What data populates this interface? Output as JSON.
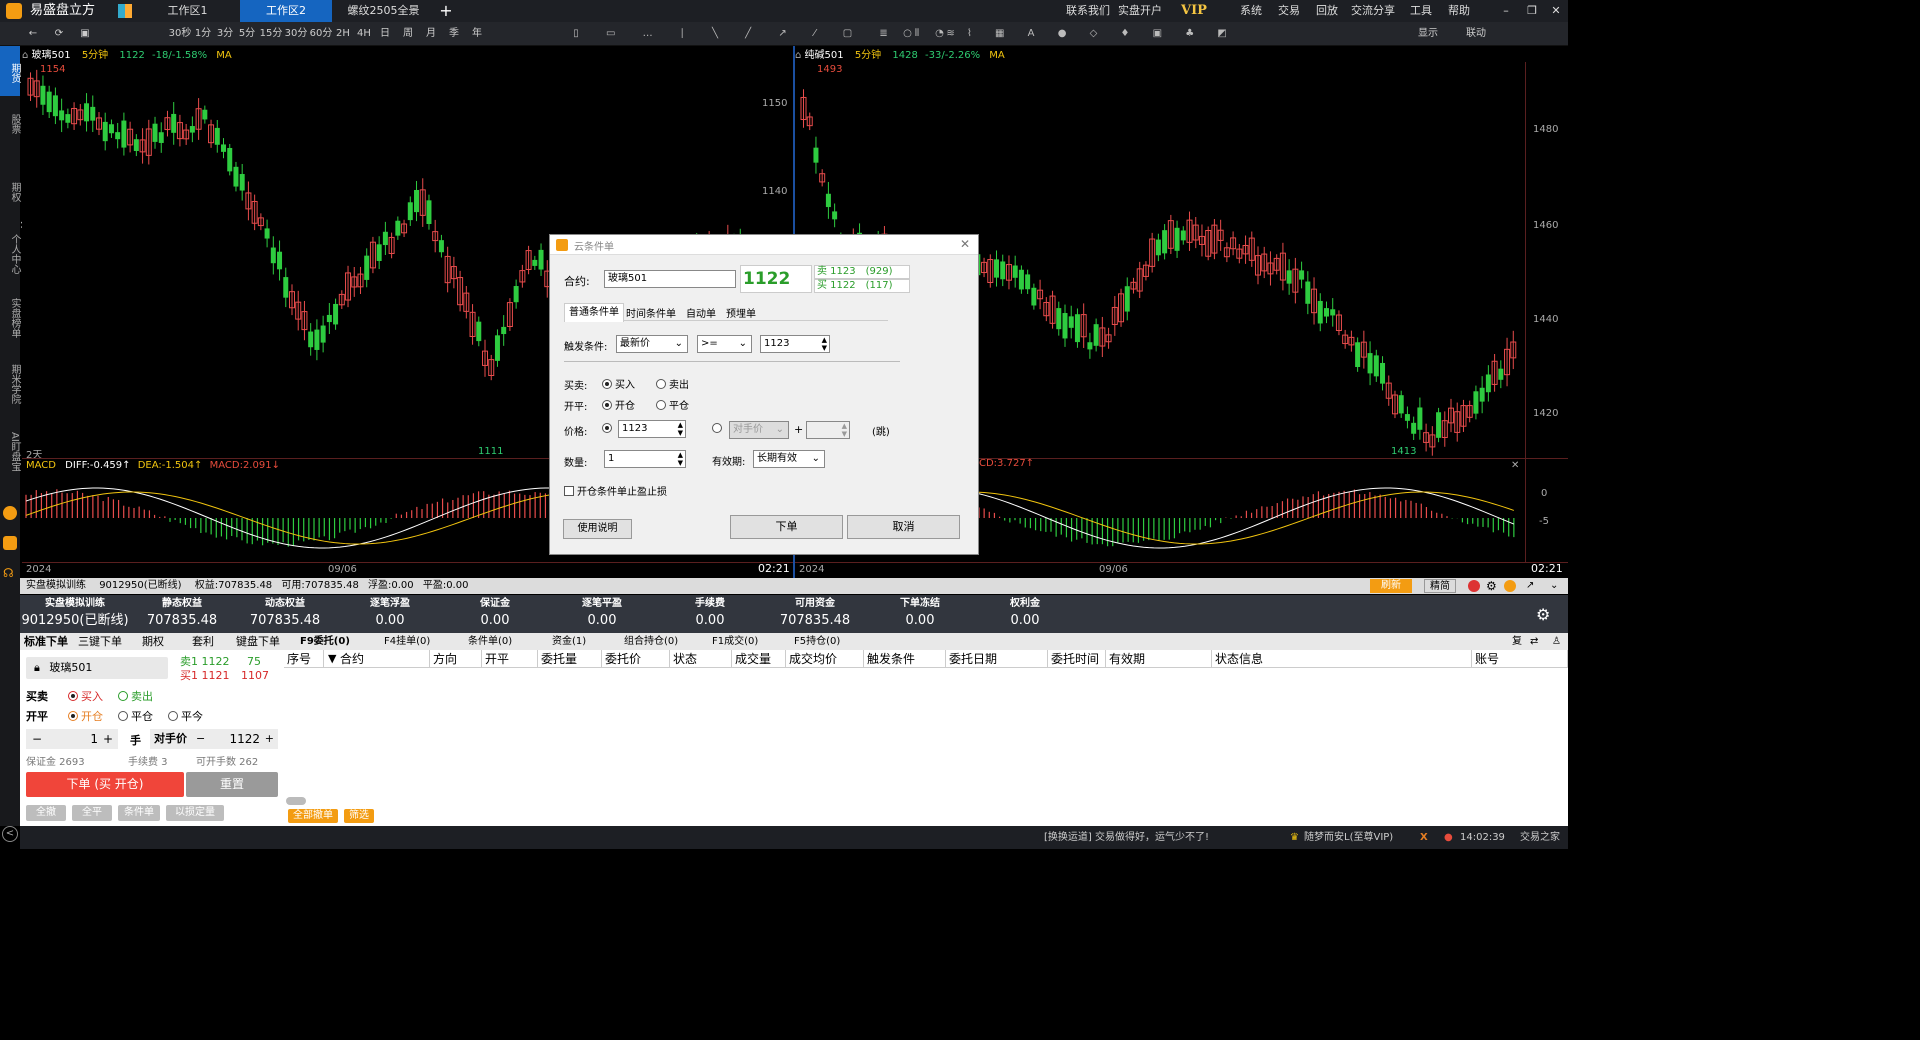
{
  "app": {
    "title": "易盛盘立方",
    "tabs": [
      "工作区1",
      "工作区2",
      "螺纹2505全景"
    ],
    "right_links": [
      "联系我们",
      "实盘开户",
      "VIP",
      "系统",
      "交易",
      "回放",
      "交流分享",
      "工具",
      "帮助"
    ]
  },
  "toolbar": {
    "periods": [
      "30秒",
      "1分",
      "3分",
      "5分",
      "15分",
      "30分",
      "60分",
      "2H",
      "4H",
      "日",
      "周",
      "月",
      "季",
      "年"
    ],
    "right": [
      "显示",
      "联动"
    ]
  },
  "leftnav": [
    "期货",
    "股票",
    "期权",
    "个人中心",
    "实盘榜单",
    "期米学院",
    "AI盯盘宝"
  ],
  "chart_left": {
    "symbol": "玻璃501",
    "period": "5分钟",
    "price": "1122",
    "change": "-18/-1.58%",
    "indicator": "MA",
    "high_label": "1154",
    "low_label": "1111",
    "axis": [
      "1150",
      "1140"
    ],
    "days": "2天",
    "macd": {
      "name": "MACD",
      "diff": "DIFF:-0.459↑",
      "dea": "DEA:-1.504↑",
      "macd": "MACD:2.091↓"
    },
    "dates": [
      "2024",
      "09/06"
    ],
    "time": "02:21"
  },
  "chart_right": {
    "symbol": "纯碱501",
    "period": "5分钟",
    "price": "1428",
    "change": "-33/-2.26%",
    "indicator": "MA",
    "high_label": "1493",
    "low_label": "1413",
    "axis": [
      "1480",
      "1460",
      "1440",
      "1420"
    ],
    "macd_axis": [
      "0",
      "-5"
    ],
    "macd_value": "CD:3.727↑",
    "dates": [
      "2024",
      "09/06"
    ],
    "time": "02:21"
  },
  "panel": {
    "account": "实盘模拟训练",
    "id": "9012950(已断线)",
    "equity": "权益:707835.48",
    "available": "可用:707835.48",
    "float": "浮盈:0.00",
    "close": "平盈:0.00",
    "refresh": "刷新",
    "mode": "精简"
  },
  "accounts": [
    {
      "label": "实盘模拟训练",
      "value": "9012950(已断线)"
    },
    {
      "label": "静态权益",
      "value": "707835.48"
    },
    {
      "label": "动态权益",
      "value": "707835.48"
    },
    {
      "label": "逐笔浮盈",
      "value": "0.00"
    },
    {
      "label": "保证金",
      "value": "0.00"
    },
    {
      "label": "逐笔平盈",
      "value": "0.00"
    },
    {
      "label": "手续费",
      "value": "0.00"
    },
    {
      "label": "可用资金",
      "value": "707835.48"
    },
    {
      "label": "下单冻结",
      "value": "0.00"
    },
    {
      "label": "权利金",
      "value": "0.00"
    }
  ],
  "order": {
    "tabs": [
      "标准下单",
      "三键下单",
      "期权",
      "套利",
      "键盘下单"
    ],
    "contract": "玻璃501",
    "sell_label": "卖1",
    "sell_price": "1122",
    "sell_qty": "75",
    "buy_label": "买1",
    "buy_price": "1121",
    "buy_qty": "1107",
    "side_label": "买卖",
    "buy": "买入",
    "sell": "卖出",
    "oc_label": "开平",
    "open": "开仓",
    "close": "平仓",
    "closetoday": "平今",
    "qty": "1",
    "unit": "手",
    "price_type": "对手价",
    "price": "1122",
    "margin": "保证金 2693",
    "fee": "手续费 3",
    "openable": "可开手数 262",
    "submit": "下单 (买 开仓)",
    "reset": "重置",
    "bottom": [
      "全撤",
      "全平",
      "条件单",
      "以损定量"
    ]
  },
  "table": {
    "tabs": [
      "F9委托(0)",
      "F4挂单(0)",
      "条件单(0)",
      "资金(1)",
      "组合持仓(0)",
      "F1成交(0)",
      "F5持仓(0)"
    ],
    "headers": [
      "序号",
      "合约",
      "方向",
      "开平",
      "委托量",
      "委托价",
      "状态",
      "成交量",
      "成交均价",
      "触发条件",
      "委托日期",
      "委托时间",
      "有效期",
      "状态信息",
      "账号"
    ],
    "actions": [
      "全部撤单",
      "筛选"
    ],
    "right_icons": [
      "复"
    ]
  },
  "status": {
    "message": "[换换运道] 交易做得好，运气少不了!",
    "user": "随梦而安L(至尊VIP)",
    "time": "14:02:39",
    "site": "交易之家"
  },
  "dialog": {
    "title": "云条件单",
    "contract_label": "合约:",
    "contract": "玻璃501",
    "price": "1122",
    "ask": "卖 1123",
    "ask_qty": "(929)",
    "bid": "买 1122",
    "bid_qty": "(117)",
    "tabs": [
      "普通条件单",
      "时间条件单",
      "自动单",
      "预埋单"
    ],
    "trigger_label": "触发条件:",
    "trigger_field": "最新价",
    "trigger_op": ">=",
    "trigger_value": "1123",
    "side_label": "买卖:",
    "buy": "买入",
    "sell": "卖出",
    "oc_label": "开平:",
    "open": "开仓",
    "close": "平仓",
    "price_label": "价格:",
    "price_value": "1123",
    "opp_price": "对手价",
    "tick_unit": "(跳)",
    "qty_label": "数量:",
    "qty": "1",
    "valid_label": "有效期:",
    "valid": "长期有效",
    "stop_label": "开仓条件单止盈止损",
    "help": "使用说明",
    "submit": "下单",
    "cancel": "取消"
  }
}
